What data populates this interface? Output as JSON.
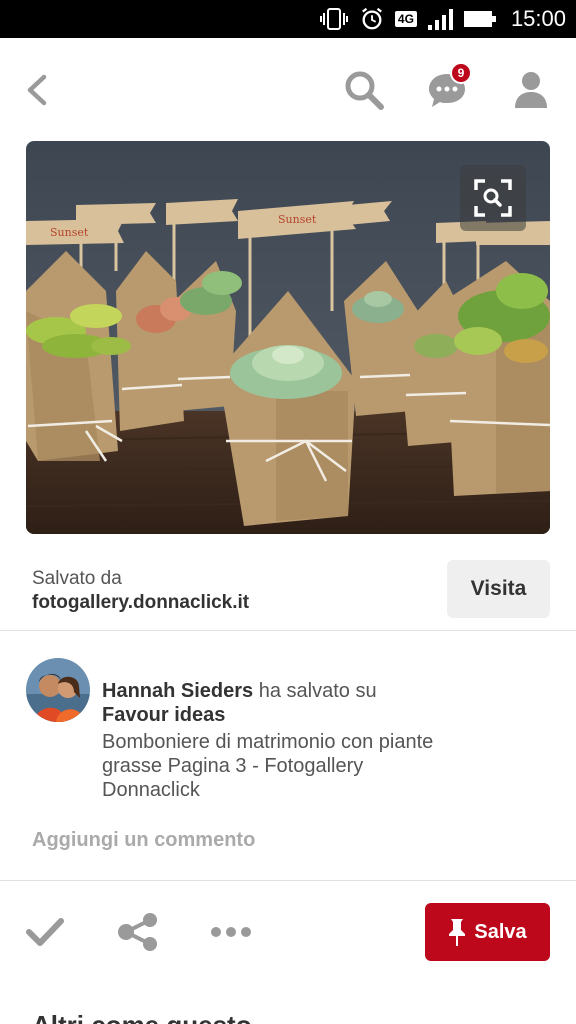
{
  "status_bar": {
    "network": "4G",
    "time": "15:00"
  },
  "nav": {
    "notification_count": "9",
    "icons": [
      "back-arrow-icon",
      "search-icon",
      "messages-icon",
      "profile-icon"
    ]
  },
  "pin": {
    "image_description_icon": "visual-search-icon",
    "image_flags": [
      "Sunset",
      "Sunset"
    ]
  },
  "source": {
    "label": "Salvato da",
    "domain": "fotogallery.donnaclick.it",
    "visit_label": "Visita"
  },
  "saver": {
    "name": "Hannah Sieders",
    "action": " ha salvato su",
    "board": "Favour ideas",
    "description": "Bomboniere di matrimonio con piante grasse Pagina 3 - Fotogallery Donnaclick"
  },
  "comment": {
    "placeholder": "Aggiungi un commento"
  },
  "actions": {
    "save_label": "Salva",
    "icons": [
      "check-icon",
      "share-icon",
      "more-icon",
      "pin-icon"
    ]
  },
  "more_like_this": {
    "title": "Altri come questo"
  },
  "colors": {
    "brand_red": "#bd081c",
    "status_bar_bg": "#000000",
    "icon_gray": "#9a9a9a"
  }
}
